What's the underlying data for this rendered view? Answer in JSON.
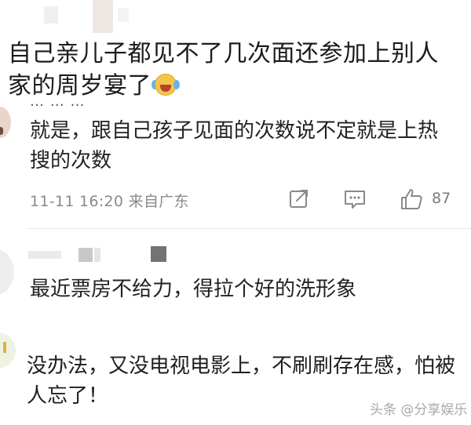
{
  "quoted_comment": {
    "text": "自己亲儿子都见不了几次面还参加上别人家的周岁宴了",
    "emoji": "crying-laughing-emoji"
  },
  "reply": {
    "username_partial": "… …   …",
    "text": "就是，跟自己孩子见面的次数说不定就是上热搜的次数",
    "timestamp": "11-11 16:20",
    "location": "来自广东",
    "like_count": "87",
    "icons": {
      "share": "share-icon",
      "comment": "comment-icon",
      "like": "like-icon"
    },
    "colors": {
      "icon": "#8a8a8a",
      "meta_text": "#8a8a8a"
    }
  },
  "comment_2": {
    "text": "最近票房不给力，得拉个好的洗形象"
  },
  "comment_3": {
    "text": "没办法，又没电视电影上，不刷刷存在感，怕被人忘了！"
  },
  "watermark": "头条 @分享娱乐"
}
